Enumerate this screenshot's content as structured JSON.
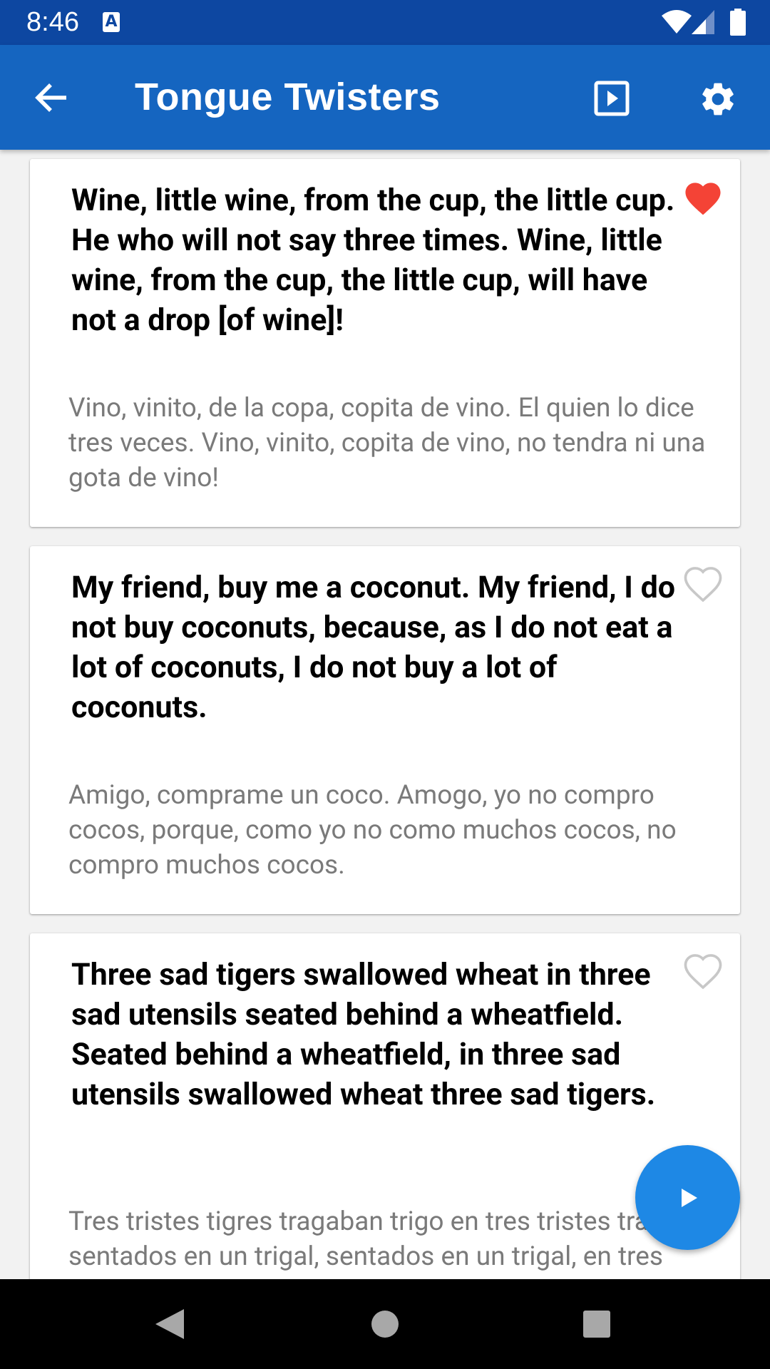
{
  "status_bar": {
    "time": "8:46",
    "icons": [
      "a-notification-icon",
      "wifi-icon",
      "cell-signal-icon",
      "battery-icon"
    ]
  },
  "app_bar": {
    "title": "Tongue Twisters",
    "back_icon": "arrow-back-icon",
    "play_all_icon": "slideshow-icon",
    "settings_icon": "gear-icon"
  },
  "cards": [
    {
      "english": "Wine, little wine, from the cup, the little cup. He who will not say three times. Wine, little wine, from the cup, the little cup, will have not a drop [of wine]!",
      "spanish": "Vino, vinito, de la copa, copita de vino. El quien lo dice tres veces. Vino, vinito, copita de vino, no tendra ni una gota de vino!",
      "favorited": true
    },
    {
      "english": "My friend, buy me a coconut. My friend, I do not buy coconuts, because, as I do not eat a lot of coconuts, I do not buy a lot of coconuts.",
      "spanish": "Amigo, comprame un coco. Amogo, yo no compro cocos, porque, como yo no como muchos cocos, no compro muchos cocos.",
      "favorited": false
    },
    {
      "english": "Three sad tigers swallowed wheat in three sad utensils seated behind a wheatfield. Seated behind a wheatfield, in three sad utensils swallowed wheat three sad tigers.",
      "spanish": "Tres tristes tigres tragaban trigo en tres tristes trastos sentados en un trigal, sentados en un trigal, en tres tristes trastos tragaban trigo tres tristes tigres.",
      "favorited": false
    }
  ],
  "fab": {
    "icon": "play-icon"
  },
  "nav_bar": {
    "icons": [
      "nav-back-icon",
      "nav-home-icon",
      "nav-recents-icon"
    ]
  },
  "colors": {
    "status_bar": "#0d47a1",
    "app_bar": "#1565c0",
    "fab": "#1e88e5",
    "heart_filled": "#f44336",
    "heart_outline": "#c8c8c8",
    "spanish_text": "#7a7a7a"
  }
}
